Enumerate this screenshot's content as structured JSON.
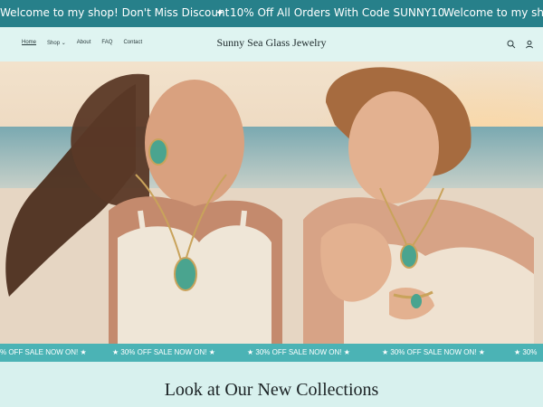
{
  "announcement": {
    "messages": [
      "Welcome to my shop! Don't Miss Discount",
      "✦",
      "10% Off All Orders With Code SUNNY10",
      "Welcome to my sho"
    ]
  },
  "header": {
    "nav": [
      {
        "label": "Home",
        "active": true
      },
      {
        "label": "Shop",
        "has_dropdown": true
      },
      {
        "label": "About"
      },
      {
        "label": "FAQ"
      },
      {
        "label": "Contact"
      }
    ],
    "brand": "Sunny Sea Glass Jewelry",
    "icons": [
      "search-icon",
      "account-icon"
    ]
  },
  "hero": {
    "image": "two women on beach wearing sea glass macrame jewelry"
  },
  "sale_marquee": {
    "items": [
      "% OFF SALE NOW ON! ★",
      "★ 30% OFF SALE NOW ON! ★",
      "★ 30% OFF SALE NOW ON! ★",
      "★ 30% OFF SALE NOW ON! ★",
      "★ 30% OFF SALE NOW ON! ★",
      "★ 30%"
    ]
  },
  "section": {
    "title": "Look at Our New Collections"
  },
  "colors": {
    "announcement_bg": "#27808a",
    "page_bg": "#d8f1ee",
    "marquee_bg": "#4bb3b5"
  }
}
